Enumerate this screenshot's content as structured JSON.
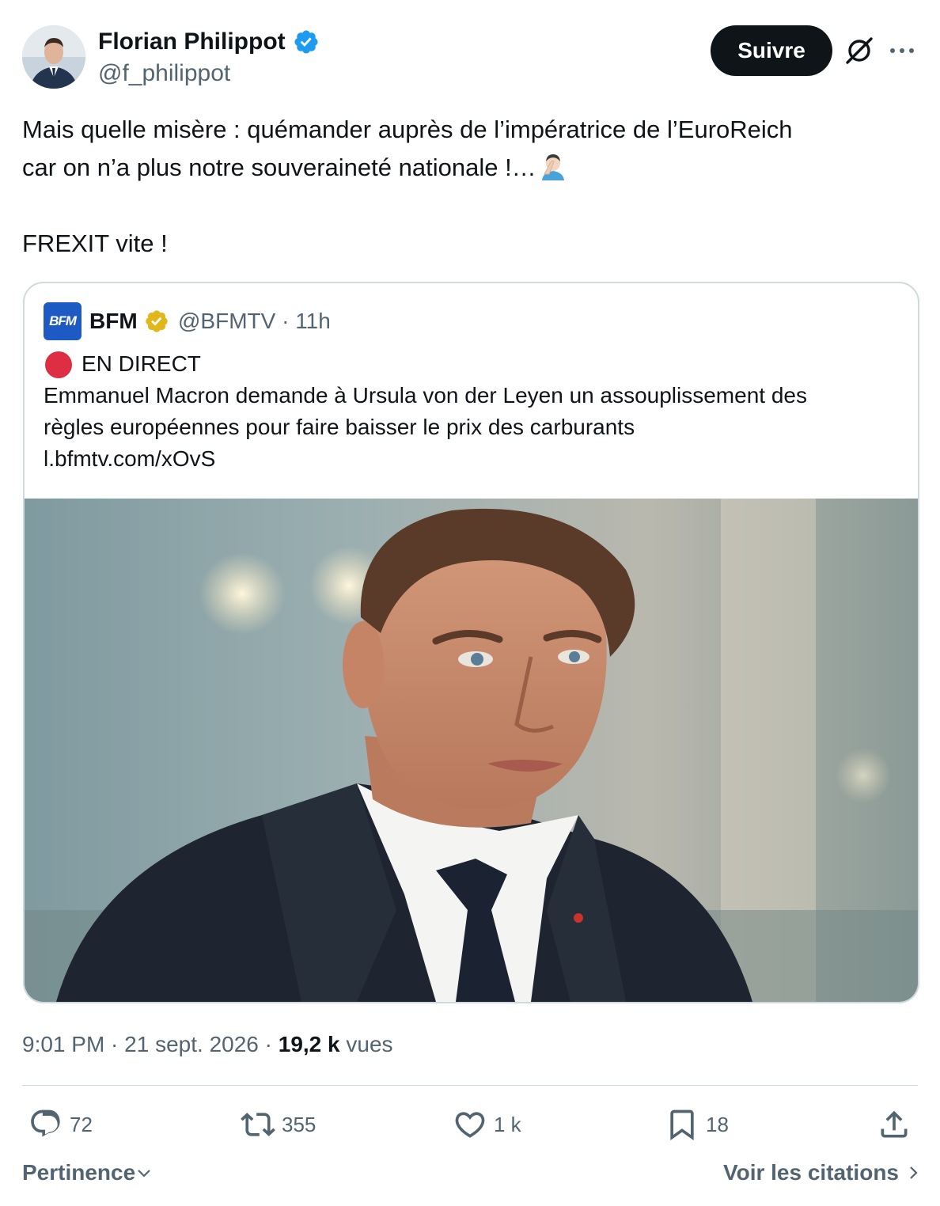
{
  "author": {
    "name": "Florian Philippot",
    "handle": "@f_philippot"
  },
  "header": {
    "follow_label": "Suivre"
  },
  "tweet": {
    "line1": "Mais quelle misère : quémander auprès de l’impératrice de l’EuroReich",
    "line2": "car on n’a plus notre souveraineté nationale !…",
    "line3": "FREXIT vite !"
  },
  "quote": {
    "logo_text": "BFM",
    "name": "BFM",
    "handle_time": "@BFMTV · 11h",
    "live_label": "EN DIRECT",
    "text_line1": "Emmanuel Macron demande à Ursula von der Leyen un assouplissement des",
    "text_line2": "règles européennes pour faire baisser le prix des carburants",
    "link": "l.bfmtv.com/xOvS"
  },
  "meta": {
    "time_date": "9:01 PM · 21 sept. 2026 · ",
    "views_count": "19,2 k",
    "views_label": "vues"
  },
  "actions": {
    "replies": "72",
    "reposts": "355",
    "likes": "1 k",
    "bookmarks": "18"
  },
  "footer": {
    "sort_label": "Pertinence",
    "quotes_label": "Voir les citations"
  },
  "colors": {
    "text": "#0f1419",
    "muted": "#536471",
    "verified_blue": "#1d9bf0",
    "gold": "#e2b719",
    "border": "#cfd9de",
    "live_red": "#dd2e44"
  }
}
